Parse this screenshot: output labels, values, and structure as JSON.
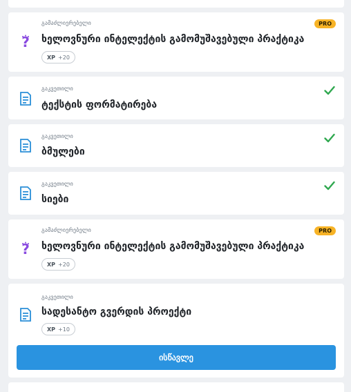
{
  "items": [
    {
      "kind": "გამაძლიერებელი",
      "title": "ხელოვნური ინტელექტის გამომუშავებული პრაქტიკა",
      "xp_label": "XP",
      "xp_value": "+20",
      "badge": "PRO",
      "icon": "question-icon"
    },
    {
      "kind": "გაკვეთილი",
      "title": "ტექსტის ფორმატირება",
      "icon": "lesson-document-icon",
      "completed": true
    },
    {
      "kind": "გაკვეთილი",
      "title": "ბმულები",
      "icon": "lesson-document-icon",
      "completed": true
    },
    {
      "kind": "გაკვეთილი",
      "title": "სიები",
      "icon": "lesson-document-icon",
      "completed": true
    },
    {
      "kind": "გამაძლიერებელი",
      "title": "ხელოვნური ინტელექტის გამომუშავებული პრაქტიკა",
      "xp_label": "XP",
      "xp_value": "+20",
      "badge": "PRO",
      "icon": "question-icon"
    },
    {
      "kind": "გაკვეთილი",
      "title": "სადესანტო გვერდის პროექტი",
      "xp_label": "XP",
      "xp_value": "+10",
      "icon": "lesson-document-icon",
      "button_label": "ისწავლე"
    }
  ],
  "colors": {
    "accent": "#2a93e0",
    "pro_badge": "#f7b326",
    "check": "#2fa84f",
    "question_icon": "#8a4be0",
    "lesson_icon": "#2a8fd8"
  }
}
